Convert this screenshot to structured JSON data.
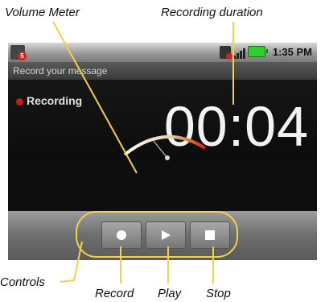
{
  "callouts": {
    "volume_meter": "Volume Meter",
    "recording_duration": "Recording duration",
    "controls": "Controls",
    "record": "Record",
    "play": "Play",
    "stop": "Stop"
  },
  "statusbar": {
    "time": "1:35 PM",
    "notification_badge": "5"
  },
  "titlebar": {
    "title": "Record your message"
  },
  "recorder": {
    "status": "Recording",
    "elapsed": "00:04"
  },
  "icons": {
    "record": "record-icon",
    "play": "play-icon",
    "stop": "stop-icon"
  },
  "colors": {
    "callout_line": "#f1d245",
    "recording_dot": "#c81a1a",
    "battery": "#2fcf2f"
  }
}
